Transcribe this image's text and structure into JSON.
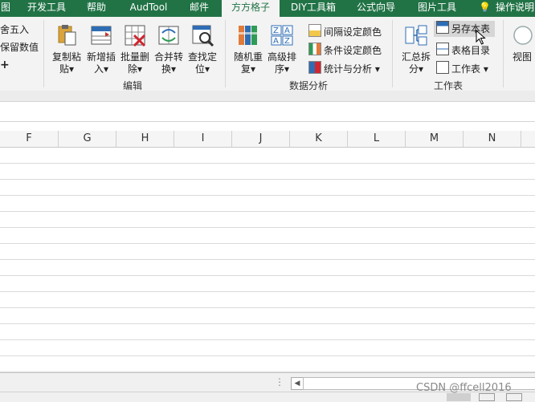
{
  "tabs": [
    {
      "label": "图",
      "active": false
    },
    {
      "label": "开发工具",
      "active": false
    },
    {
      "label": "帮助",
      "active": false
    },
    {
      "label": "AudTool",
      "active": false
    },
    {
      "label": "邮件",
      "active": false
    },
    {
      "label": "方方格子",
      "active": true
    },
    {
      "label": "DIY工具箱",
      "active": false
    },
    {
      "label": "公式向导",
      "active": false
    },
    {
      "label": "图片工具",
      "active": false
    }
  ],
  "tell_me": "操作说明",
  "ribbon": {
    "left_partial": [
      "舍五入",
      "保留数值",
      "+"
    ],
    "edit_group": {
      "label": "编辑",
      "buttons": [
        {
          "line1": "复制粘",
          "line2": "贴▾"
        },
        {
          "line1": "新增插",
          "line2": "入▾"
        },
        {
          "line1": "批量删",
          "line2": "除▾"
        },
        {
          "line1": "合并转",
          "line2": "换▾"
        },
        {
          "line1": "查找定",
          "line2": "位▾"
        }
      ]
    },
    "analysis_group": {
      "label": "数据分析",
      "buttons": [
        {
          "line1": "随机重",
          "line2": "复▾"
        },
        {
          "line1": "高级排",
          "line2": "序▾"
        }
      ],
      "small": [
        "间隔设定颜色",
        "条件设定颜色",
        "统计与分析 ▾"
      ]
    },
    "sheet_group": {
      "label": "工作表",
      "big": {
        "line1": "汇总拆",
        "line2": "分▾"
      },
      "small": [
        "另存本表",
        "表格目录",
        "工作表 ▾"
      ]
    },
    "view": {
      "line1": "视图"
    }
  },
  "columns": [
    "F",
    "G",
    "H",
    "I",
    "J",
    "K",
    "L",
    "M",
    "N"
  ],
  "watermark": "CSDN @ffcell2016",
  "colors": {
    "ribbon_green": "#217346",
    "hover_highlight": "#d6d6d6"
  }
}
